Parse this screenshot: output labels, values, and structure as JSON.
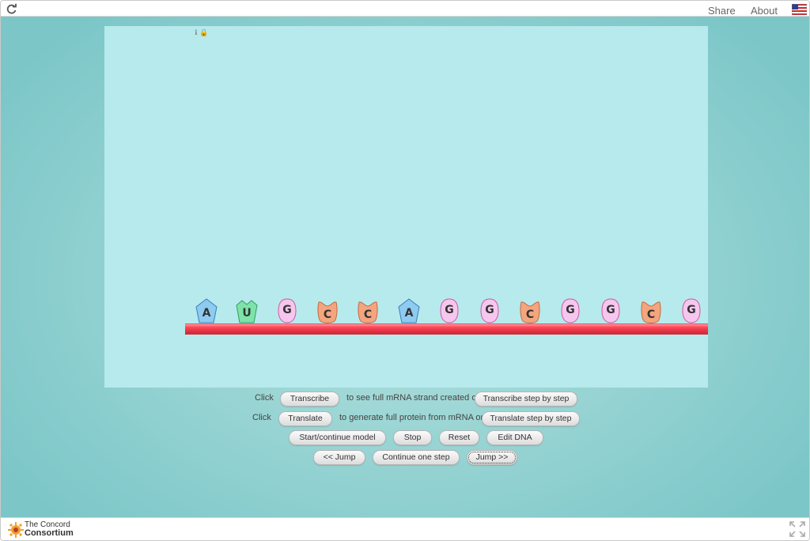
{
  "header": {
    "share_label": "Share",
    "about_label": "About"
  },
  "model": {
    "nucleotides": [
      "A",
      "U",
      "G",
      "C",
      "C",
      "A",
      "G",
      "G",
      "C",
      "G",
      "G",
      "C",
      "G"
    ],
    "colors": {
      "A": "#8ecbf0",
      "U": "#7ee3a8",
      "G": "#f6c6ef",
      "C": "#f4a57e",
      "strand": "#e83344"
    }
  },
  "controls": {
    "row1": {
      "prefix": "Click",
      "button1": "Transcribe",
      "middle": "to see full mRNA strand created or",
      "button2": "Transcribe step by step"
    },
    "row2": {
      "prefix": "Click",
      "button1": "Translate",
      "middle": "to generate full protein from mRNA or",
      "button2": "Translate step by step"
    },
    "row3": [
      "Start/continue model",
      "Stop",
      "Reset",
      "Edit DNA"
    ],
    "row4": [
      "<< Jump",
      "Continue one step",
      "Jump >>"
    ]
  },
  "footer": {
    "logo_line1": "The Concord",
    "logo_line2": "Consortium"
  }
}
